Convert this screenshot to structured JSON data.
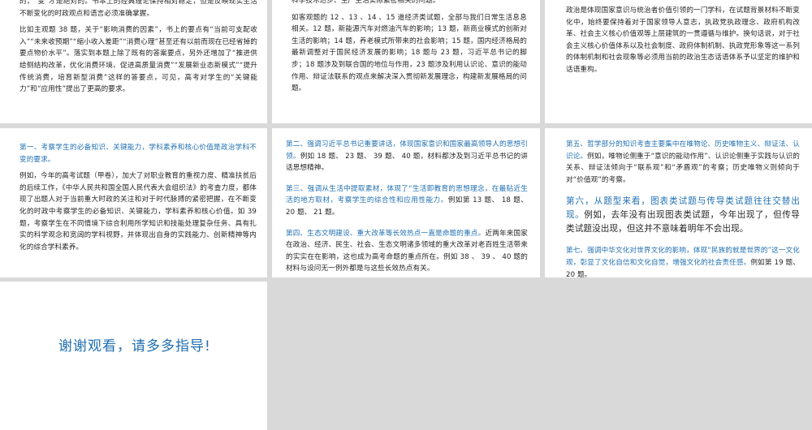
{
  "slides": {
    "s1": {
      "p1": "的，“变”才是绝对的。书本上的经典理论保持相对稳定，但是反映现实生活不断变化的时政观点和语言必须准确掌握。",
      "p2": "比如主观题 38 题，关于“影响消费的因素”，书上的要点有“当前可支配收入”“未来收预期”“缩小收入差距”“消费心理”甚至还有以前而现在已经省掉的要点物价水平”。落实到本题上除了既有的答案要点，另外还增加了“推进供给侧结构改革，优化消费环境、促进高质量消费”“发展新业态新模式”“提升传统消费，培育新型消费”这样的答要点，可见，高考对学生的“关键能力”和“应用性”提出了更高的要求。"
    },
    "s2": {
      "p1": "科学技术进步、生产生活实际紧密相关的问题。",
      "p2": "如客观题的 12 、13 、14 、15 道经济类试题，全部与我们日常生活息息相关。12 题，新能源汽车对燃油汽车的影响；13 题，新商业模式的创新对生活的影响；14 题，养老模式所带来的社会影响；15 题，国内经济格局的最新调整对于国民经济发展的影响；18 题与 23 题，习近平总书记的脚步；18 题涉及到联合国的地位与作用，23 题涉及利用认识论、意识的能动作用、辩证法联系的观点来解决深入贯彻新发展理念，构建新发展格局的问题。"
    },
    "s3": {
      "p1": "政治是体现国家意识与统治者价值引领的一门学科，在试题背景材料不断变化中，始终要保持着对于国家领导人意志，执政党执政理念、政府机构改革、社会主义核心价值观等上层建筑的一贯遵循与维护。换句话说，对于社会主义核心价值体系以及社会制度、政府体制机制、执政党形象等这一系列的体制机制和社会现象等必须用当前的政治生态话语体系予以坚定的维护和话语重构。"
    },
    "s4": {
      "heading": "第一、考察学生的必备知识、关键能力，学科素养和核心价值是政治学科不变的要求。",
      "p1": "例如，今年的高考试题（甲卷），加大了对职业教育的重视力度、精准扶贫后的后续工作，《中华人民共和国全国人民代表大会组织法》的考查力度，都体现了出题人对于当前重大时政的关注和对于时代脉搏的紧密把握，在不断变化的时政中考察学生的必备知识、关键能力，学科素养和核心价值。如 39 题，考察学生在不同情境下综合利用所学知识和技能处理复杂任务、具有扎实的科学观念和宽阔的学科视野，并体现出自身的实践能力、创新精神等内化的综合学科素养。"
    },
    "s5": {
      "h1": "第二、强调习近平总书记重要讲话，体现国家意识和国家最高领导人的思想引领。",
      "t1": "例如 18 题、 23 题、 39 题、 40 题，材料都涉及到习近平总书记的讲话思想精神。",
      "h2": "第三、强调从生活中提取素材，体现了“生活即教育的思想理念，在最贴近生活的地方取材，考察学生的综合性和应用性能力。",
      "t2": "例如第 13 题、 18 题、 20 题、 21 题。",
      "h3": "第四、生态文明建设、重大改革等长效热点一直是命题的重点。",
      "t3": "近两年来国家在政治、经济、民生、社会、生态文明诸多领域的重大改革对老百姓生活带来的实实在在影响，这也成为高考命题的重点所在。例如 38 、 39 、 40 题的材料与设问无一例外都是与这些长效热点有关。"
    },
    "s6": {
      "h1": "第五、哲学部分的知识考查主要集中在唯物论、历史唯物主义、辩证法、认识论。",
      "t1": "例如，唯物论侧重于“意识的能动作用”、认识论侧重于实践与认识的关系、辩证法倾向于“联系观”和“矛盾观”的考察；历史唯物义则倾向于对“价值观”的考察。",
      "h2": "第六，从题型来看，图表类试题与传导类试题往往交替出现。",
      "t2": "例如，去年没有出现图表类试题，今年出现了，但传导类试题没出现，但这并不意味着明年不会出现。",
      "h3": "第七、强调中华文化对世界文化的影响，体现“民族的就是世界的”这一文化观，彰显了文化自信和文化自觉，增强文化的社会责任感。",
      "t3": "例如第 19 题、 20 题。"
    },
    "s7": {
      "thanks": "谢谢观看，请多多指导!"
    }
  },
  "colors": {
    "accent": "#1f6fb2",
    "background": "#d9d9d9",
    "slide": "#ffffff"
  }
}
